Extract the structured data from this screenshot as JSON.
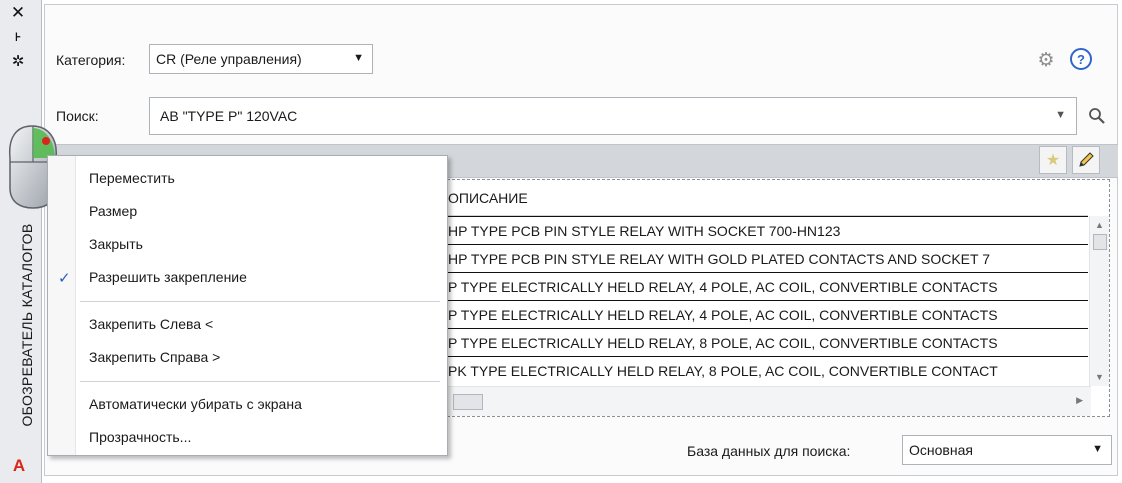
{
  "palette": {
    "close_glyph": "✕",
    "autohide_glyph": "⊦",
    "properties_glyph": "✲",
    "title": "ОБОЗРЕВАТЕЛЬ КАТАЛОГОВ",
    "app_glyph": "A"
  },
  "category": {
    "label": "Категория:",
    "value": "CR (Реле управления)"
  },
  "search": {
    "label": "Поиск:",
    "value": "AB \"TYPE P\" 120VAC"
  },
  "table": {
    "column_header": "ОПИСАНИЕ",
    "rows": [
      "HP TYPE PCB PIN STYLE RELAY WITH SOCKET 700-HN123",
      "HP TYPE PCB PIN STYLE RELAY WITH GOLD PLATED CONTACTS AND SOCKET 7",
      "P TYPE ELECTRICALLY HELD RELAY, 4 POLE, AC COIL, CONVERTIBLE CONTACTS",
      "P TYPE ELECTRICALLY HELD RELAY, 4 POLE, AC COIL, CONVERTIBLE CONTACTS",
      "P TYPE ELECTRICALLY HELD RELAY, 8 POLE, AC COIL, CONVERTIBLE CONTACTS",
      "PK TYPE ELECTRICALLY HELD RELAY, 8 POLE, AC COIL, CONVERTIBLE CONTACT"
    ]
  },
  "database": {
    "label": "База данных для поиска:",
    "value": "Основная"
  },
  "context_menu": {
    "items": [
      "Переместить",
      "Размер",
      "Закрыть",
      "Разрешить закрепление",
      "Закрепить Слева <",
      "Закрепить Справа >",
      "Автоматически убирать с экрана",
      "Прозрачность..."
    ],
    "checked_item": "Разрешить закрепление"
  },
  "icons": {
    "gear": "gear-icon",
    "help": "help-icon",
    "search": "magnifier-icon",
    "favorite": "star-icon",
    "edit": "pencil-icon",
    "mouse": "mouse-icon"
  },
  "colors": {
    "accent_blue": "#2e66c8",
    "app_red": "#d9261c",
    "check_blue": "#2a5db8",
    "band_gray": "#d3d6da"
  }
}
